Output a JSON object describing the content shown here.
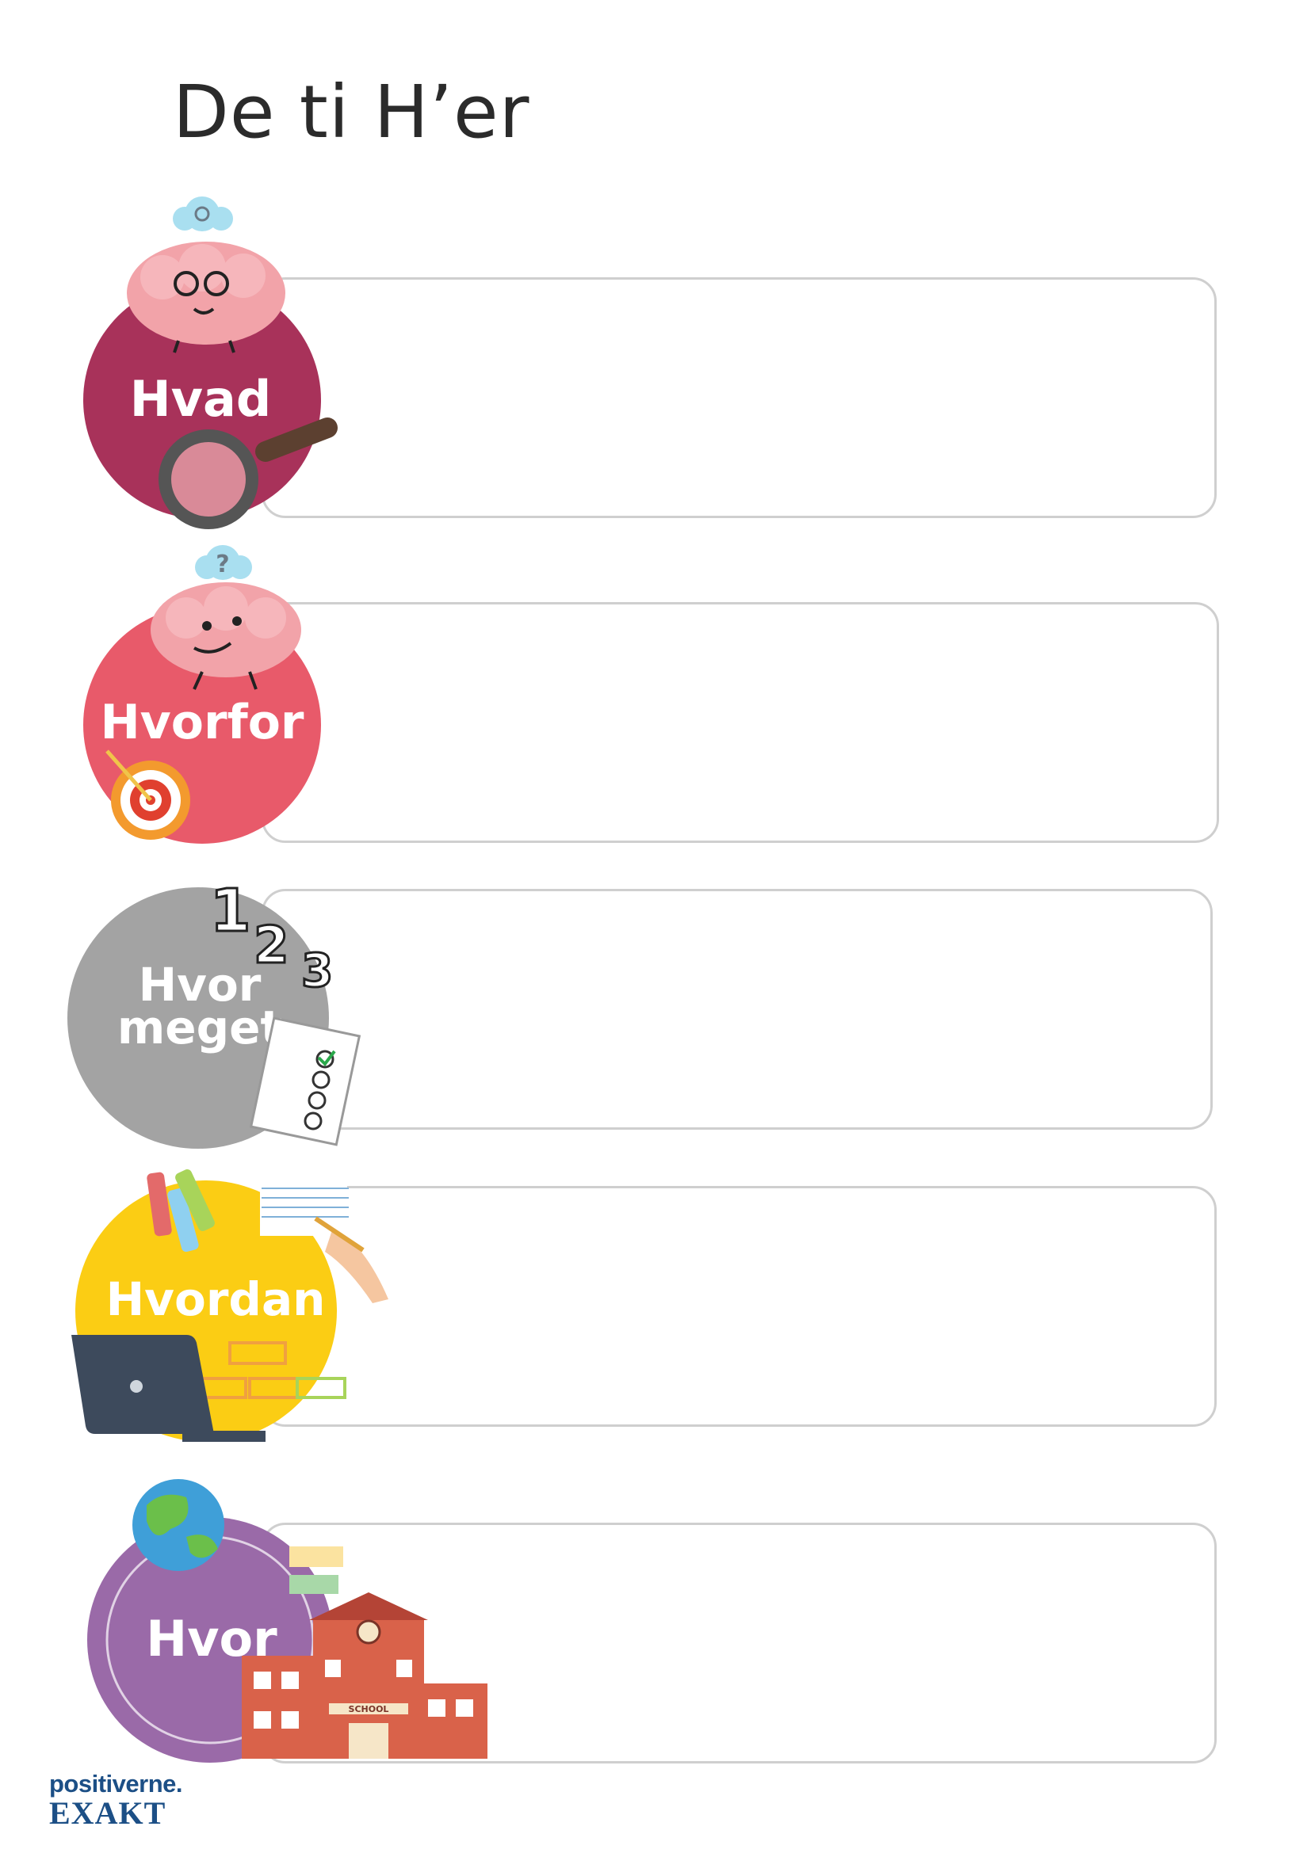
{
  "page": {
    "title": "De ti H’er"
  },
  "sections": [
    {
      "label": "Hvad",
      "color": "#a8325a",
      "icon": "thinking-brain-icon"
    },
    {
      "label": "Hvorfor",
      "color": "#e85a6a",
      "icon": "confused-brain-icon"
    },
    {
      "label": "Hvor",
      "label2": "meget",
      "color": "#a3a3a3",
      "icon": "checklist-icon"
    },
    {
      "label": "Hvordan",
      "color": "#fbcd14",
      "icon": "laptop-icon"
    },
    {
      "label": "Hvor",
      "color": "#9a6aa8",
      "icon": "school-building-icon"
    }
  ],
  "decor": {
    "counting_numbers": [
      "1",
      "2",
      "3"
    ],
    "school_sign": "SCHOOL"
  },
  "brand": {
    "top": "positiverne.",
    "bottom": "EXAKT"
  }
}
